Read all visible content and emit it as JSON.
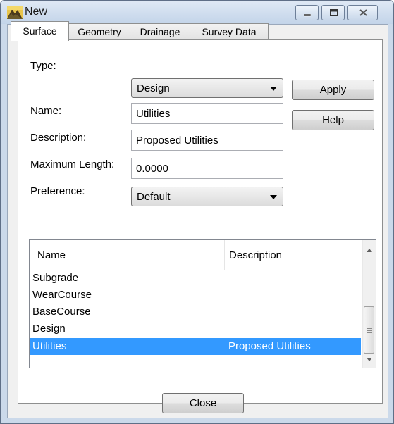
{
  "window": {
    "title": "New"
  },
  "tabs": [
    {
      "label": "Surface",
      "active": true
    },
    {
      "label": "Geometry",
      "active": false
    },
    {
      "label": "Drainage",
      "active": false
    },
    {
      "label": "Survey Data",
      "active": false
    }
  ],
  "form": {
    "type_label": "Type:",
    "type_value": "Design",
    "name_label": "Name:",
    "name_value": "Utilities",
    "description_label": "Description:",
    "description_value": "Proposed Utilities",
    "max_length_label": "Maximum Length:",
    "max_length_value": "0.0000",
    "preference_label": "Preference:",
    "preference_value": "Default"
  },
  "buttons": {
    "apply": "Apply",
    "help": "Help",
    "close": "Close"
  },
  "list": {
    "columns": [
      "Name",
      "Description"
    ],
    "rows": [
      {
        "name": "Subgrade",
        "description": ""
      },
      {
        "name": "WearCourse",
        "description": ""
      },
      {
        "name": "BaseCourse",
        "description": ""
      },
      {
        "name": "Design",
        "description": ""
      },
      {
        "name": "Utilities",
        "description": "Proposed Utilities",
        "selected": true
      }
    ]
  },
  "colors": {
    "selection": "#3399ff",
    "frame": "#cbd9ea"
  }
}
